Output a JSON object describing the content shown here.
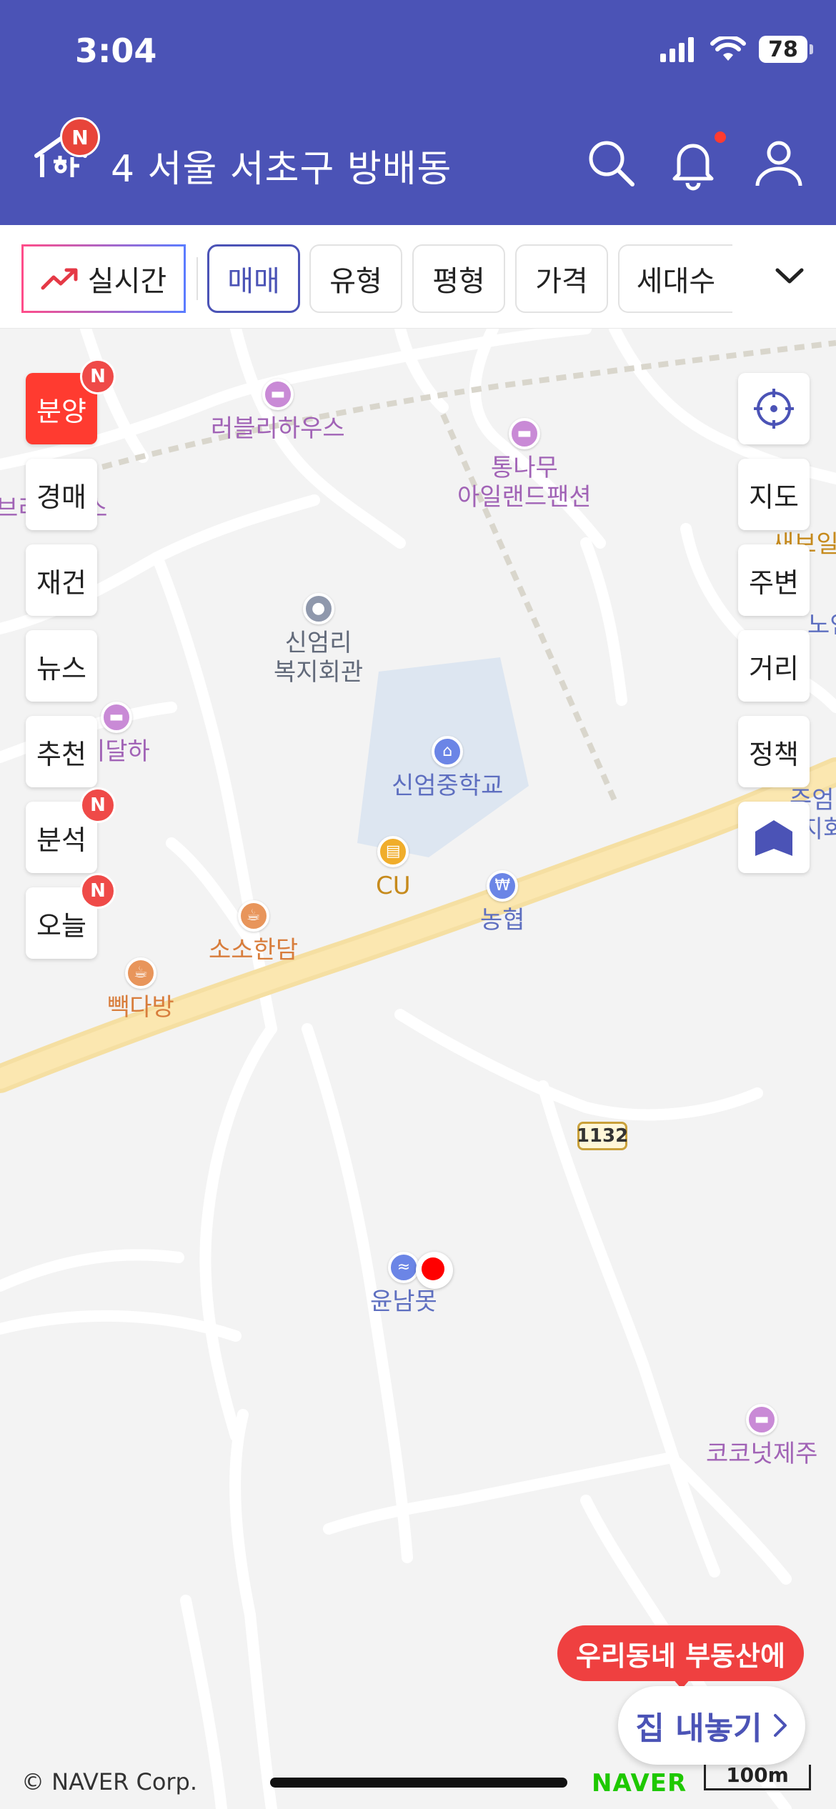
{
  "status": {
    "time": "3:04",
    "battery": "78"
  },
  "header": {
    "logo_badge": "N",
    "location": "4 서울 서초구 방배동"
  },
  "filters": {
    "realtime": "실시간",
    "chips": [
      "매매",
      "유형",
      "평형",
      "가격",
      "세대수"
    ]
  },
  "left_menu": [
    {
      "label": "분양",
      "badge": "N"
    },
    {
      "label": "경매"
    },
    {
      "label": "재건"
    },
    {
      "label": "뉴스"
    },
    {
      "label": "추천"
    },
    {
      "label": "분석",
      "badge": "N"
    },
    {
      "label": "오늘",
      "badge": "N"
    }
  ],
  "right_menu": [
    "지도",
    "주변",
    "거리",
    "정책"
  ],
  "map": {
    "pois": {
      "lovely_house": "러블리하우스",
      "tree_island_1": "통나무",
      "tree_island_2": "아일랜드팬션",
      "welfare_1": "신엄리",
      "welfare_2": "복지회관",
      "school": "신엄중학교",
      "cu": "CU",
      "nonghyup": "농협",
      "sosohandam": "소소한담",
      "ppaekdabang": "빽다방",
      "idalha": "이달하",
      "yunnammot": "윤남못",
      "coconut": "코코넛제주",
      "edge_left": "브리하우스",
      "edge_right_1": "새보일",
      "edge_right_2": "노인",
      "edge_right_3": "주엄리",
      "edge_right_4": "지회"
    },
    "route_number": "1132"
  },
  "promo": {
    "bubble": "우리동네 부동산에",
    "button": "집 내놓기"
  },
  "footer": {
    "copyright": "© NAVER Corp.",
    "brand": "NAVER",
    "scale": "100m"
  }
}
